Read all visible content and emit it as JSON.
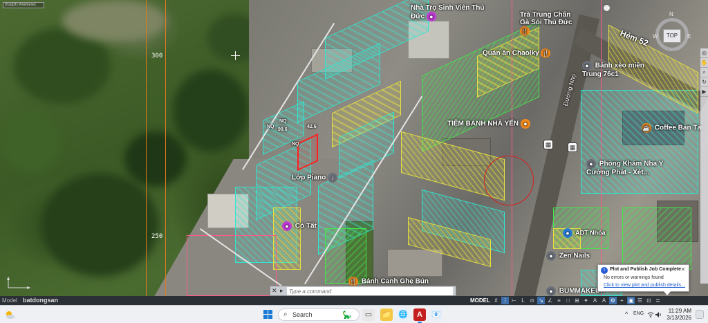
{
  "window": {
    "model_tab_label": "[Top][2D Wireframe]",
    "viewcube_top": "TOP",
    "viewcube_compass": {
      "n": "N",
      "w": "W",
      "e": "E",
      "s": "S"
    }
  },
  "map": {
    "grid_labels": [
      "300",
      "250"
    ],
    "street_labels": {
      "hem52": "Hẻm 52",
      "road_vertical": "Đường Nhọ"
    },
    "poi": [
      {
        "name": "Nhà Trọ Sinh Viên Thủ Đức",
        "pin": "purple"
      },
      {
        "name": "Trà Trung Chấn Gà Sói Thủ Đức",
        "pin": "orange"
      },
      {
        "name": "Quán ăn Chaolky",
        "pin": "orange"
      },
      {
        "name": "Bánh xèo miền Trung 76c1",
        "pin": "gray"
      },
      {
        "name": "TIỆM BÁNH NHÀ YẾN",
        "pin": "orange"
      },
      {
        "name": "Coffee Bản Tài",
        "pin": "orange"
      },
      {
        "name": "Phòng Khám Nha Y Cường Phát - Xét...",
        "pin": "gray"
      },
      {
        "name": "Lớp Piano",
        "pin": "gray"
      },
      {
        "name": "Cỏ Tất",
        "pin": "purple"
      },
      {
        "name": "Zen Nails",
        "pin": "gray"
      },
      {
        "name": "Bánh Canh Ghẹ Bún Riêu...",
        "pin": "orange"
      },
      {
        "name": "BUMMAKEUP",
        "pin": "gray"
      },
      {
        "name": "ADT Nhóa",
        "pin": "blue"
      }
    ],
    "parcel_labels": [
      "NQ",
      "NQ",
      "99.6",
      "NQ",
      "42.6"
    ]
  },
  "cmdline": {
    "close": "✕",
    "placeholder": "Type a command"
  },
  "notification": {
    "title": "Plot and Publish Job Complete",
    "message": "No errors or warnings found",
    "link": "Click to view plot and publish details..."
  },
  "statusbar": {
    "layout_tabs": "Model",
    "model_label": "MODEL",
    "tools": [
      "#",
      "⋮",
      "⊢",
      "L",
      "⊙",
      "↘",
      "∠",
      "≡",
      "□",
      "⊞",
      "✦",
      "A",
      "A",
      "⚙",
      "+",
      "▣",
      "☰",
      "⊡",
      "≣"
    ]
  },
  "watermark": "batdongsan",
  "taskbar": {
    "search_placeholder": "Search",
    "apps": [
      "📁",
      "🌐",
      "A",
      "📧"
    ],
    "tray": {
      "chevron": "^",
      "language": "ENG",
      "wifi": "wifi-icon",
      "volume": "volume-icon",
      "battery": "battery-icon"
    },
    "time": "11:29 AM",
    "date": "3/13/2026"
  }
}
